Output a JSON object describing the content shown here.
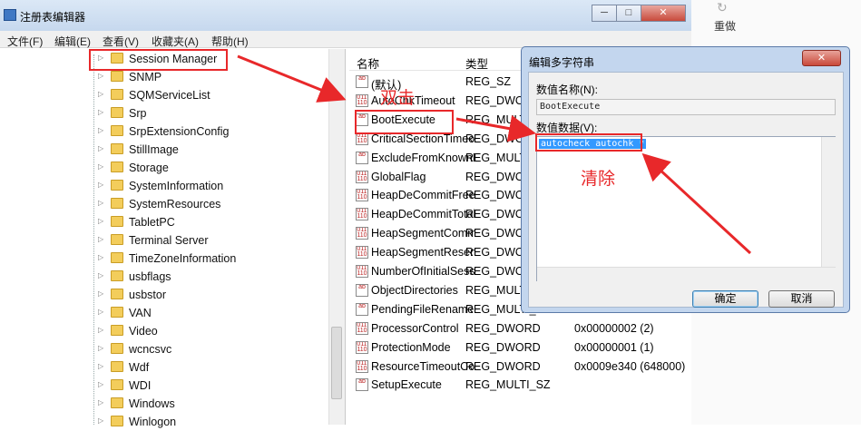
{
  "background_window": {
    "redo_label": "重做",
    "redo_icon": "↻"
  },
  "window": {
    "title": "注册表编辑器",
    "buttons": {
      "minimize": "─",
      "maximize": "□",
      "close": "✕"
    }
  },
  "menu": [
    "文件(F)",
    "编辑(E)",
    "查看(V)",
    "收藏夹(A)",
    "帮助(H)"
  ],
  "tree": {
    "items": [
      {
        "label": "Session Manager",
        "highlighted": true
      },
      {
        "label": "SNMP"
      },
      {
        "label": "SQMServiceList"
      },
      {
        "label": "Srp"
      },
      {
        "label": "SrpExtensionConfig"
      },
      {
        "label": "StillImage"
      },
      {
        "label": "Storage"
      },
      {
        "label": "SystemInformation"
      },
      {
        "label": "SystemResources"
      },
      {
        "label": "TabletPC"
      },
      {
        "label": "Terminal Server"
      },
      {
        "label": "TimeZoneInformation"
      },
      {
        "label": "usbflags"
      },
      {
        "label": "usbstor"
      },
      {
        "label": "VAN"
      },
      {
        "label": "Video"
      },
      {
        "label": "wcncsvc"
      },
      {
        "label": "Wdf"
      },
      {
        "label": "WDI"
      },
      {
        "label": "Windows"
      },
      {
        "label": "Winlogon"
      }
    ]
  },
  "values": {
    "headers": {
      "name": "名称",
      "type": "类型"
    },
    "rows": [
      {
        "name": "(默认)",
        "type": "REG_SZ",
        "data": ""
      },
      {
        "name": "AutoChkTimeout",
        "type": "REG_DWORD",
        "data": ""
      },
      {
        "name": "BootExecute",
        "type": "REG_MULTI_SZ",
        "data": ""
      },
      {
        "name": "CriticalSectionTimeout",
        "type": "REG_DWORD",
        "data": ""
      },
      {
        "name": "ExcludeFromKnownDlls",
        "type": "REG_MULTI_SZ",
        "data": ""
      },
      {
        "name": "GlobalFlag",
        "type": "REG_DWORD",
        "data": ""
      },
      {
        "name": "HeapDeCommitFreeBlock",
        "type": "REG_DWORD",
        "data": ""
      },
      {
        "name": "HeapDeCommitTotalFree",
        "type": "REG_DWORD",
        "data": ""
      },
      {
        "name": "HeapSegmentCommit",
        "type": "REG_DWORD",
        "data": ""
      },
      {
        "name": "HeapSegmentReserve",
        "type": "REG_DWORD",
        "data": ""
      },
      {
        "name": "NumberOfInitialSessions",
        "type": "REG_DWORD",
        "data": ""
      },
      {
        "name": "ObjectDirectories",
        "type": "REG_MULTI_SZ",
        "data": ""
      },
      {
        "name": "PendingFileRenameOperations",
        "type": "REG_MULTI_SZ",
        "data": ""
      },
      {
        "name": "ProcessorControl",
        "type": "REG_DWORD",
        "data": "0x00000002 (2)"
      },
      {
        "name": "ProtectionMode",
        "type": "REG_DWORD",
        "data": "0x00000001 (1)"
      },
      {
        "name": "ResourceTimeoutCount",
        "type": "REG_DWORD",
        "data": "0x0009e340 (648000)"
      },
      {
        "name": "SetupExecute",
        "type": "REG_MULTI_SZ",
        "data": ""
      }
    ]
  },
  "dialog": {
    "title": "编辑多字符串",
    "close": "✕",
    "name_label": "数值名称(N):",
    "name_value": "BootExecute",
    "data_label": "数值数据(V):",
    "data_value": "autocheck autochk *",
    "ok": "确定",
    "cancel": "取消"
  },
  "annotations": {
    "double_click": "双击",
    "clear": "清除",
    "color": "#e8282a"
  }
}
